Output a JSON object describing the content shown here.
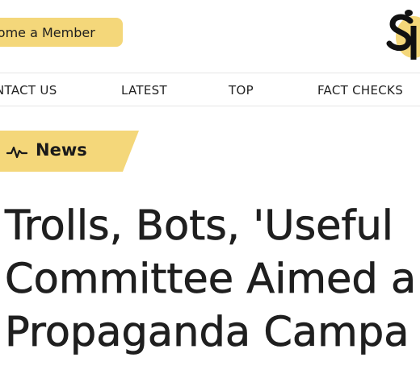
{
  "header": {
    "member_button_label": "come a Member"
  },
  "nav": {
    "items": [
      {
        "label": "NTACT US"
      },
      {
        "label": "LATEST"
      },
      {
        "label": "TOP"
      },
      {
        "label": "FACT CHECKS"
      }
    ]
  },
  "category": {
    "label": "News",
    "icon": "pulse-icon",
    "color": "#f4d77a"
  },
  "article": {
    "headline_lines": [
      "Trolls, Bots, 'Useful",
      "Committee Aimed a",
      "Propaganda Campa"
    ]
  },
  "colors": {
    "accent": "#f4d77a",
    "text": "#1f1f1f",
    "divider": "#e6e6e6"
  }
}
